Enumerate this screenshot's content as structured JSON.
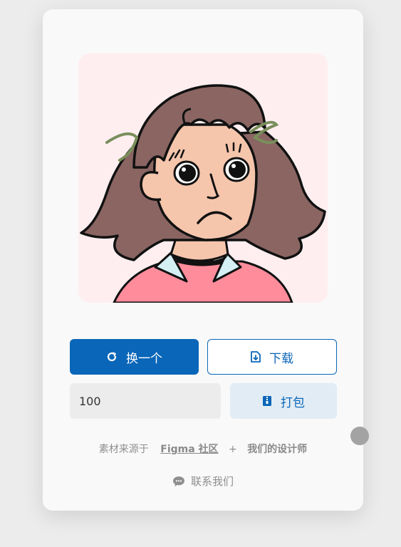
{
  "avatar": {
    "icon": "girl-avatar-illustration"
  },
  "actions": {
    "swap_label": "换一个",
    "download_label": "下载",
    "pack_label": "打包"
  },
  "count_input": {
    "value": "100"
  },
  "credits": {
    "prefix": "素材来源于",
    "source": "Figma 社区",
    "plus": "+",
    "designers": "我们的设计师"
  },
  "contact": {
    "label": "联系我们",
    "icon": "chat-bubble-icon"
  },
  "colors": {
    "primary": "#0a66b8",
    "card_bg": "#f9f9f9",
    "avatar_bg": "#ffeef0"
  }
}
